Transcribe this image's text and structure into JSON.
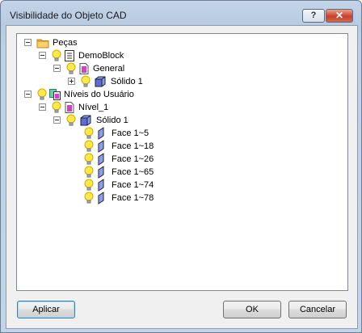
{
  "window": {
    "title": "Visibilidade do Objeto CAD",
    "help_glyph": "?",
    "close_glyph": "✕"
  },
  "tree": {
    "nodes": [
      {
        "label": "Peças",
        "icon": "folder-icon"
      },
      {
        "label": "DemoBlock",
        "icon": "document-icon"
      },
      {
        "label": "General",
        "icon": "layer-icon"
      },
      {
        "label": "Sólido 1",
        "icon": "solid-icon"
      },
      {
        "label": "Níveis do Usuário",
        "icon": "levels-icon"
      },
      {
        "label": "Nível_1",
        "icon": "layer-icon"
      },
      {
        "label": "Sólido 1",
        "icon": "solid-icon"
      },
      {
        "label": "Face 1~5",
        "icon": "face-icon"
      },
      {
        "label": "Face 1~18",
        "icon": "face-icon"
      },
      {
        "label": "Face 1~26",
        "icon": "face-icon"
      },
      {
        "label": "Face 1~65",
        "icon": "face-icon"
      },
      {
        "label": "Face 1~74",
        "icon": "face-icon"
      },
      {
        "label": "Face 1~78",
        "icon": "face-icon"
      }
    ]
  },
  "buttons": {
    "apply": "Aplicar",
    "ok": "OK",
    "cancel": "Cancelar"
  },
  "colors": {
    "bulb": "#ffe94a",
    "solid": "#5a6fd8",
    "layer": "#d040c8",
    "folder": "#f5b840"
  }
}
